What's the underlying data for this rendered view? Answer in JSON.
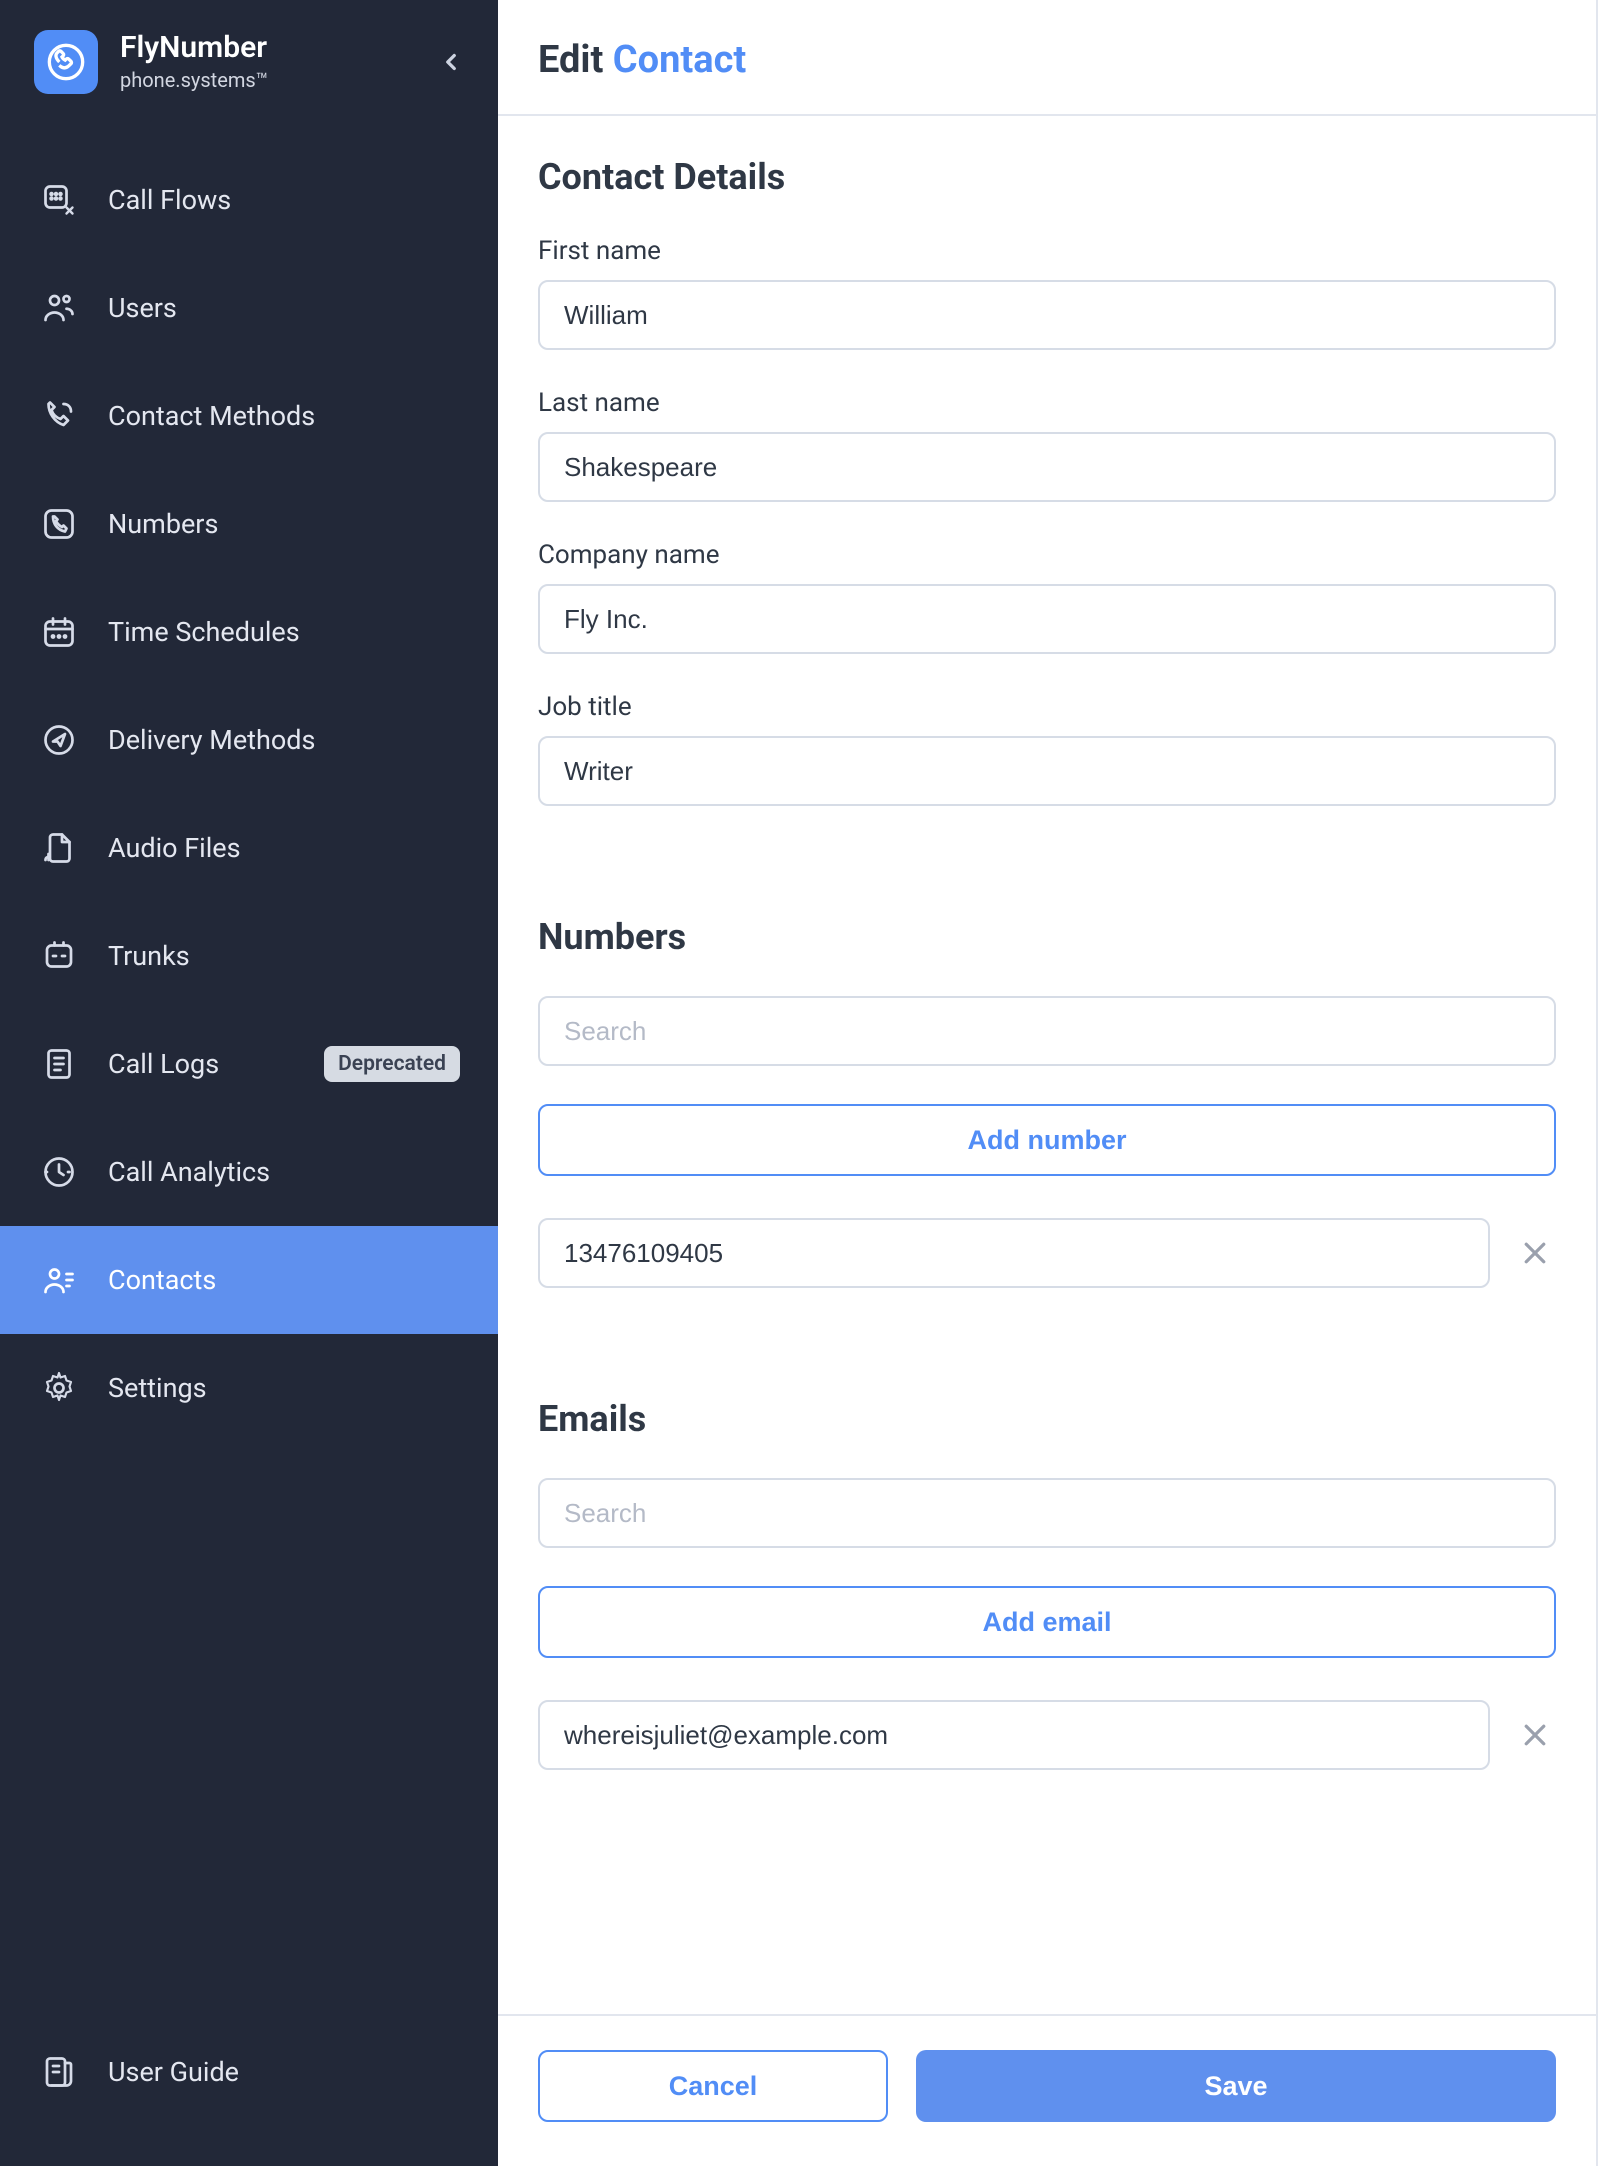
{
  "brand": {
    "title": "FlyNumber",
    "subtitle": "phone.systems™"
  },
  "sidebar": {
    "items": [
      {
        "label": "Call Flows"
      },
      {
        "label": "Users"
      },
      {
        "label": "Contact Methods"
      },
      {
        "label": "Numbers"
      },
      {
        "label": "Time Schedules"
      },
      {
        "label": "Delivery Methods"
      },
      {
        "label": "Audio Files"
      },
      {
        "label": "Trunks"
      },
      {
        "label": "Call Logs",
        "badge": "Deprecated"
      },
      {
        "label": "Call Analytics"
      },
      {
        "label": "Contacts"
      },
      {
        "label": "Settings"
      }
    ],
    "footer": {
      "label": "User Guide"
    }
  },
  "header": {
    "title_plain": "Edit ",
    "title_blue": "Contact"
  },
  "contact_details": {
    "section_title": "Contact Details",
    "fields": {
      "first_name": {
        "label": "First name",
        "value": "William"
      },
      "last_name": {
        "label": "Last name",
        "value": "Shakespeare"
      },
      "company": {
        "label": "Company name",
        "value": "Fly Inc."
      },
      "job_title": {
        "label": "Job title",
        "value": "Writer"
      }
    }
  },
  "numbers": {
    "section_title": "Numbers",
    "search_placeholder": "Search",
    "add_label": "Add number",
    "entries": [
      {
        "value": "13476109405"
      }
    ]
  },
  "emails": {
    "section_title": "Emails",
    "search_placeholder": "Search",
    "add_label": "Add email",
    "entries": [
      {
        "value": "whereisjuliet@example.com"
      }
    ]
  },
  "actions": {
    "cancel": "Cancel",
    "save": "Save"
  }
}
